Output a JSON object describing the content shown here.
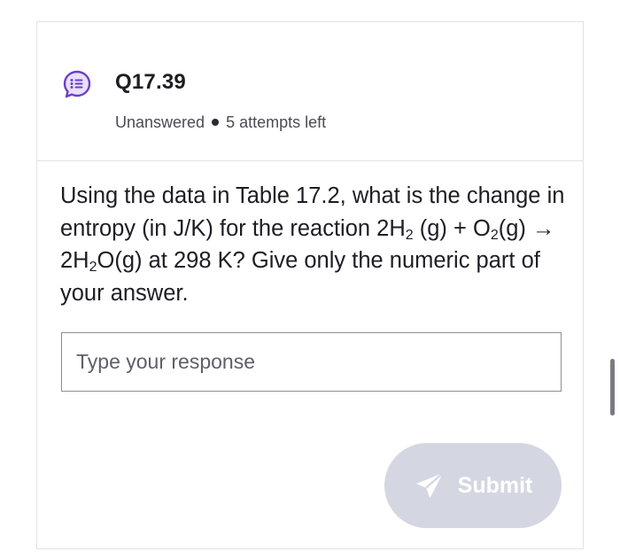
{
  "question": {
    "id": "Q17.39",
    "status": "Unanswered",
    "attempts": "5 attempts left",
    "text_parts": {
      "p1": "Using the data in Table 17.2, what is the change in entropy (in J/K) for the reaction 2H",
      "sub1": "2",
      "p2": " (g) + O",
      "sub2": "2",
      "p3": "(g) → 2H",
      "sub3": "2",
      "p4": "O(g) at 298 K? Give only the numeric part of your answer."
    }
  },
  "response": {
    "placeholder": "Type your response",
    "value": ""
  },
  "submit": {
    "label": "Submit"
  },
  "icons": {
    "question_icon": "question-list-icon",
    "submit_icon": "send-icon"
  },
  "colors": {
    "accent_purple": "#6c3fc5",
    "submit_disabled_bg": "#d4d7e1",
    "text": "#1d1d24"
  }
}
